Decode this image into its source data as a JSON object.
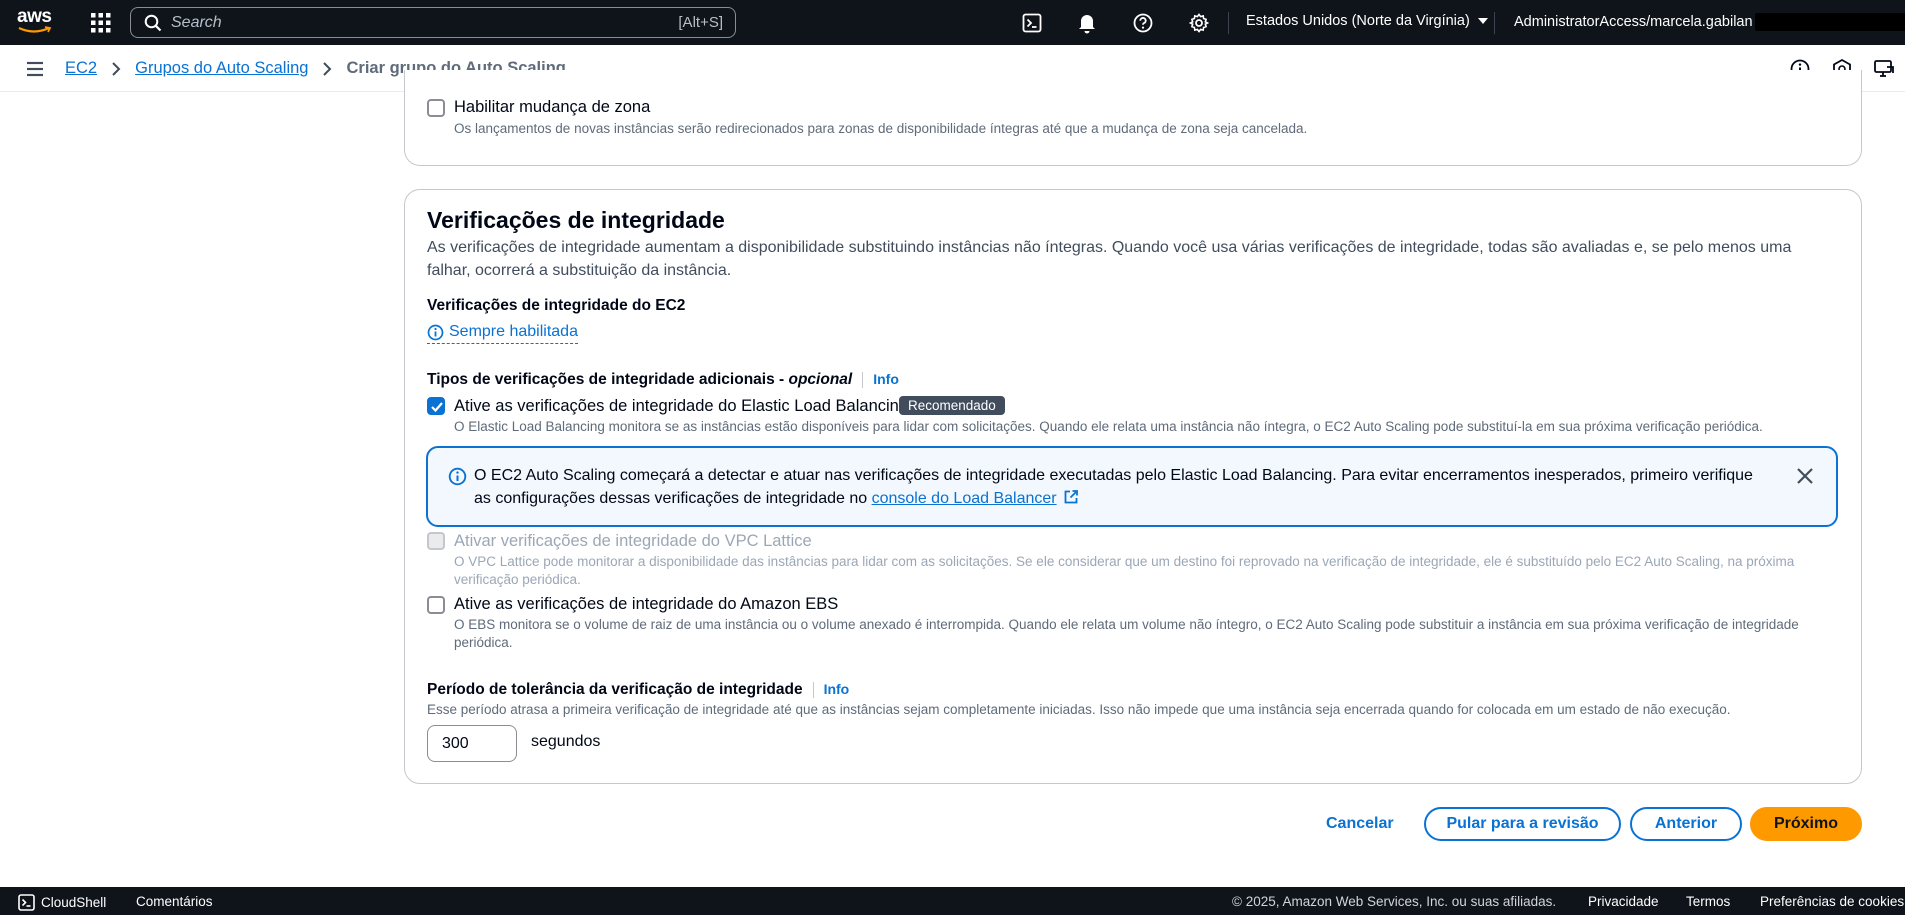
{
  "topnav": {
    "logo_text": "aws",
    "search_placeholder": "Search",
    "search_shortcut": "[Alt+S]",
    "region_label": "Estados Unidos (Norte da Virgínia)",
    "account_label": "AdministratorAccess/marcela.gabilan"
  },
  "breadcrumb": {
    "items": [
      "EC2",
      "Grupos do Auto Scaling"
    ],
    "current": "Criar grupo do Auto Scaling"
  },
  "zone_shift": {
    "label": "Habilitar mudança de zona",
    "description": "Os lançamentos de novas instâncias serão redirecionados para zonas de disponibilidade íntegras até que a mudança de zona seja cancelada.",
    "checked": false
  },
  "health": {
    "title": "Verificações de integridade",
    "intro": "As verificações de integridade aumentam a disponibilidade substituindo instâncias não íntegras. Quando você usa várias verificações de integridade, todas são avaliadas e, se pelo menos uma falhar, ocorrerá a substituição da instância.",
    "ec2_heading": "Verificações de integridade do EC2",
    "ec2_always": "Sempre habilitada",
    "additional_heading": "Tipos de verificações de integridade adicionais - ",
    "additional_optional": "opcional",
    "info_label": "Info",
    "elb": {
      "label": "Ative as verificações de integridade do Elastic Load Balancing",
      "badge": "Recomendado",
      "description": "O Elastic Load Balancing monitora se as instâncias estão disponíveis para lidar com solicitações. Quando ele relata uma instância não íntegra, o EC2 Auto Scaling pode substituí-la em sua próxima verificação periódica.",
      "checked": true
    },
    "alert": {
      "text": "O EC2 Auto Scaling começará a detectar e atuar nas verificações de integridade executadas pelo Elastic Load Balancing. Para evitar encerramentos inesperados, primeiro verifique as configurações dessas verificações de integridade no ",
      "link": "console do Load Balancer"
    },
    "vpc": {
      "label": "Ativar verificações de integridade do VPC Lattice",
      "description": "O VPC Lattice pode monitorar a disponibilidade das instâncias para lidar com as solicitações. Se ele considerar que um destino foi reprovado na verificação de integridade, ele é substituído pelo EC2 Auto Scaling, na próxima verificação periódica.",
      "checked": false,
      "disabled": true
    },
    "ebs": {
      "label": "Ative as verificações de integridade do Amazon EBS",
      "description": "O EBS monitora se o volume de raiz de uma instância ou o volume anexado é interrompida. Quando ele relata um volume não íntegro, o EC2 Auto Scaling pode substituir a instância em sua próxima verificação de integridade periódica.",
      "checked": false
    },
    "grace": {
      "heading": "Período de tolerância da verificação de integridade",
      "description": "Esse período atrasa a primeira verificação de integridade até que as instâncias sejam completamente iniciadas. Isso não impede que uma instância seja encerrada quando for colocada em um estado de não execução.",
      "value": "300",
      "units": "segundos"
    }
  },
  "actions": {
    "cancel": "Cancelar",
    "skip": "Pular para a revisão",
    "previous": "Anterior",
    "next": "Próximo"
  },
  "footer": {
    "cloudshell": "CloudShell",
    "feedback": "Comentários",
    "copyright": "© 2025, Amazon Web Services, Inc. ou suas afiliadas.",
    "privacy": "Privacidade",
    "terms": "Termos",
    "cookies": "Preferências de cookies"
  },
  "colors": {
    "nav_bg": "#0f141a",
    "link": "#0972d3",
    "primary_button": "#ff9900"
  }
}
